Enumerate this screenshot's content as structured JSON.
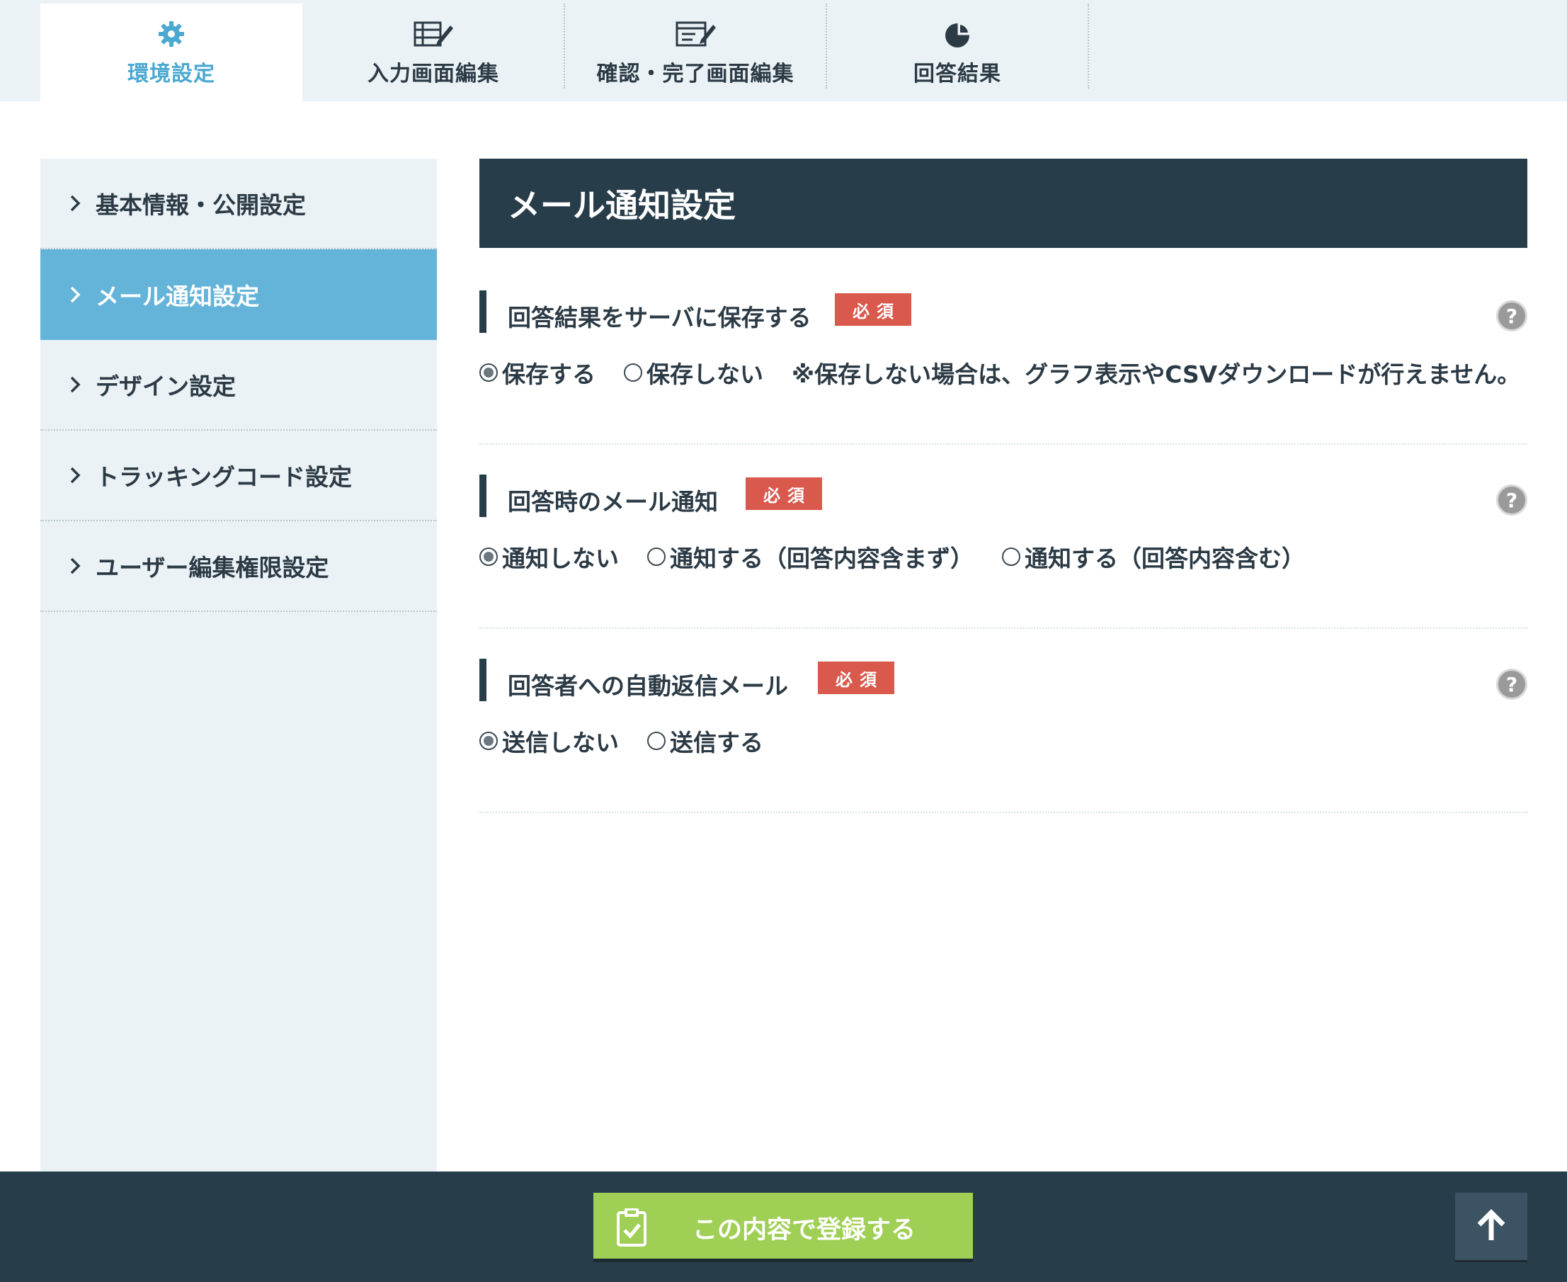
{
  "tabs": [
    {
      "label": "環境設定",
      "icon": "gear-icon",
      "active": true
    },
    {
      "label": "入力画面編集",
      "icon": "form-edit-icon",
      "active": false
    },
    {
      "label": "確認・完了画面編集",
      "icon": "page-edit-icon",
      "active": false
    },
    {
      "label": "回答結果",
      "icon": "pie-chart-icon",
      "active": false
    }
  ],
  "sidebar": {
    "items": [
      {
        "label": "基本情報・公開設定",
        "active": false
      },
      {
        "label": "メール通知設定",
        "active": true
      },
      {
        "label": "デザイン設定",
        "active": false
      },
      {
        "label": "トラッキングコード設定",
        "active": false
      },
      {
        "label": "ユーザー編集権限設定",
        "active": false
      }
    ]
  },
  "main": {
    "title": "メール通知設定",
    "required_badge": "必須",
    "help_glyph": "?",
    "sections": [
      {
        "title": "回答結果をサーバに保存する",
        "options": [
          {
            "label": "保存する",
            "selected": true
          },
          {
            "label": "保存しない",
            "selected": false
          }
        ],
        "note": "※保存しない場合は、グラフ表示やCSVダウンロードが行えません。"
      },
      {
        "title": "回答時のメール通知",
        "options": [
          {
            "label": "通知しない",
            "selected": true
          },
          {
            "label": "通知する（回答内容含まず）",
            "selected": false
          },
          {
            "label": "通知する（回答内容含む）",
            "selected": false
          }
        ]
      },
      {
        "title": "回答者への自動返信メール",
        "options": [
          {
            "label": "送信しない",
            "selected": true
          },
          {
            "label": "送信する",
            "selected": false
          }
        ]
      }
    ]
  },
  "footer": {
    "submit_label": "この内容で登録する",
    "submit_icon": "clipboard-check-icon",
    "top_icon": "arrow-up-icon"
  },
  "colors": {
    "accent": "#4aa8d1",
    "sidebar_active": "#64b4d9",
    "dark": "#283d4a",
    "badge": "#d9594c",
    "submit": "#9fcf54"
  }
}
